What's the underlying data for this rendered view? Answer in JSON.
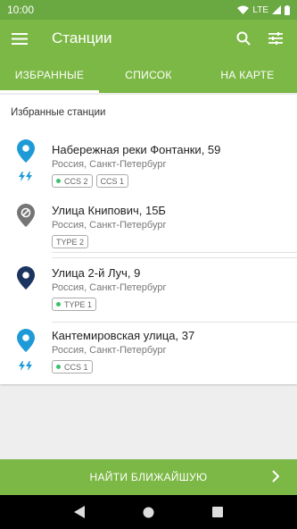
{
  "status_bar": {
    "time": "10:00",
    "network": "LTE"
  },
  "app_bar": {
    "title": "Станции"
  },
  "tabs": [
    {
      "label": "ИЗБРАННЫЕ",
      "active": true
    },
    {
      "label": "СПИСОК",
      "active": false
    },
    {
      "label": "НА КАРТЕ",
      "active": false
    }
  ],
  "favorites": {
    "section_title": "Избранные станции",
    "items": [
      {
        "name": "Набережная реки Фонтанки, 59",
        "address": "Россия, Санкт-Петербург",
        "pin_color": "#1e9bd7",
        "icon": "map-pin-icon",
        "fast_charge": true,
        "chips": [
          {
            "label": "CCS 2",
            "available": true
          },
          {
            "label": "CCS 1",
            "available": false
          }
        ]
      },
      {
        "name": "Улица Книпович, 15Б",
        "address": "Россия, Санкт-Петербург",
        "pin_color": "#757575",
        "icon": "unavailable-pin-icon",
        "fast_charge": false,
        "chips": [
          {
            "label": "TYPE 2",
            "available": false
          }
        ]
      },
      {
        "name": "Улица 2-й Луч, 9",
        "address": "Россия, Санкт-Петербург",
        "pin_color": "#1b3560",
        "icon": "map-pin-icon",
        "fast_charge": false,
        "chips": [
          {
            "label": "TYPE 1",
            "available": true
          }
        ]
      },
      {
        "name": "Кантемировская улица, 37",
        "address": "Россия, Санкт-Петербург",
        "pin_color": "#1e9bd7",
        "icon": "map-pin-icon",
        "fast_charge": true,
        "chips": [
          {
            "label": "CCS 1",
            "available": true
          }
        ]
      }
    ]
  },
  "find_nearest": {
    "label": "НАЙТИ БЛИЖАЙШУЮ"
  },
  "colors": {
    "primary": "#7cb845",
    "status_bar": "#6aa842",
    "available_dot": "#3cc06b"
  }
}
